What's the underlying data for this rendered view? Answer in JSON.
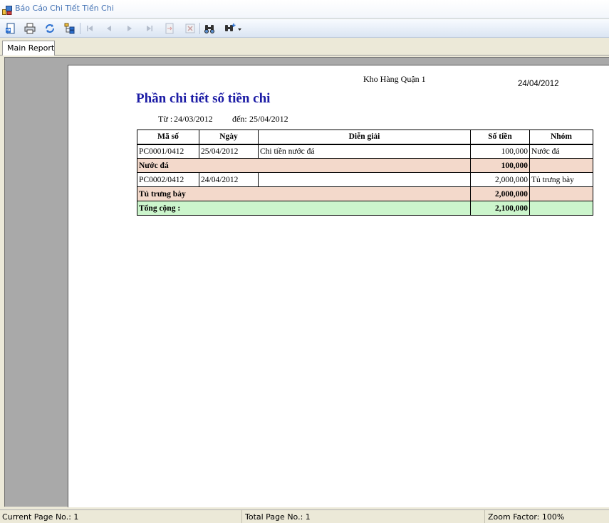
{
  "window": {
    "title": "Báo Cáo Chi Tiết Tiền Chi",
    "icon": "report-app-icon"
  },
  "toolbar": {
    "buttons": [
      {
        "name": "export-icon",
        "enabled": true
      },
      {
        "name": "print-icon",
        "enabled": true
      },
      {
        "name": "refresh-icon",
        "enabled": true
      },
      {
        "name": "group-tree-icon",
        "enabled": true
      },
      {
        "name": "first-page-icon",
        "enabled": false
      },
      {
        "name": "previous-page-icon",
        "enabled": false
      },
      {
        "name": "next-page-icon",
        "enabled": false
      },
      {
        "name": "last-page-icon",
        "enabled": false
      },
      {
        "name": "goto-page-icon",
        "enabled": false
      },
      {
        "name": "stop-icon",
        "enabled": false
      },
      {
        "name": "find-icon",
        "enabled": true
      },
      {
        "name": "zoom-icon",
        "enabled": true
      }
    ]
  },
  "tabs": [
    {
      "label": "Main Report",
      "active": true
    }
  ],
  "report": {
    "org": "Kho Hàng Quận 1",
    "print_date": "24/04/2012",
    "title": "Phần chi tiết số tiền chi",
    "from_label": "Từ :",
    "from_date": "24/03/2012",
    "to_label": "đến:",
    "to_date": "25/04/2012",
    "columns": [
      "Mã số",
      "Ngày",
      "Diễn giải",
      "Số tiền",
      "Nhóm"
    ],
    "rows": [
      {
        "type": "detail",
        "ma_so": "PC0001/0412",
        "ngay": "25/04/2012",
        "dien_giai": "Chi tiền nước đá",
        "so_tien": "100,000",
        "nhom": "Nước đá"
      },
      {
        "type": "group",
        "label": "Nước đá",
        "so_tien": "100,000"
      },
      {
        "type": "detail",
        "ma_so": "PC0002/0412",
        "ngay": "24/04/2012",
        "dien_giai": "",
        "so_tien": "2,000,000",
        "nhom": "Tủ trưng bày"
      },
      {
        "type": "group",
        "label": "Tủ trưng bày",
        "so_tien": "2,000,000"
      }
    ],
    "total": {
      "label": "Tổng cộng :",
      "so_tien": "2,100,000"
    },
    "colors": {
      "group_row": "#f3d9cb",
      "total_row": "#ccf5cc",
      "title": "#1c1ca5"
    }
  },
  "status": {
    "current_page": "Current Page No.: 1",
    "total_page": "Total Page No.: 1",
    "zoom": "Zoom Factor: 100%"
  }
}
